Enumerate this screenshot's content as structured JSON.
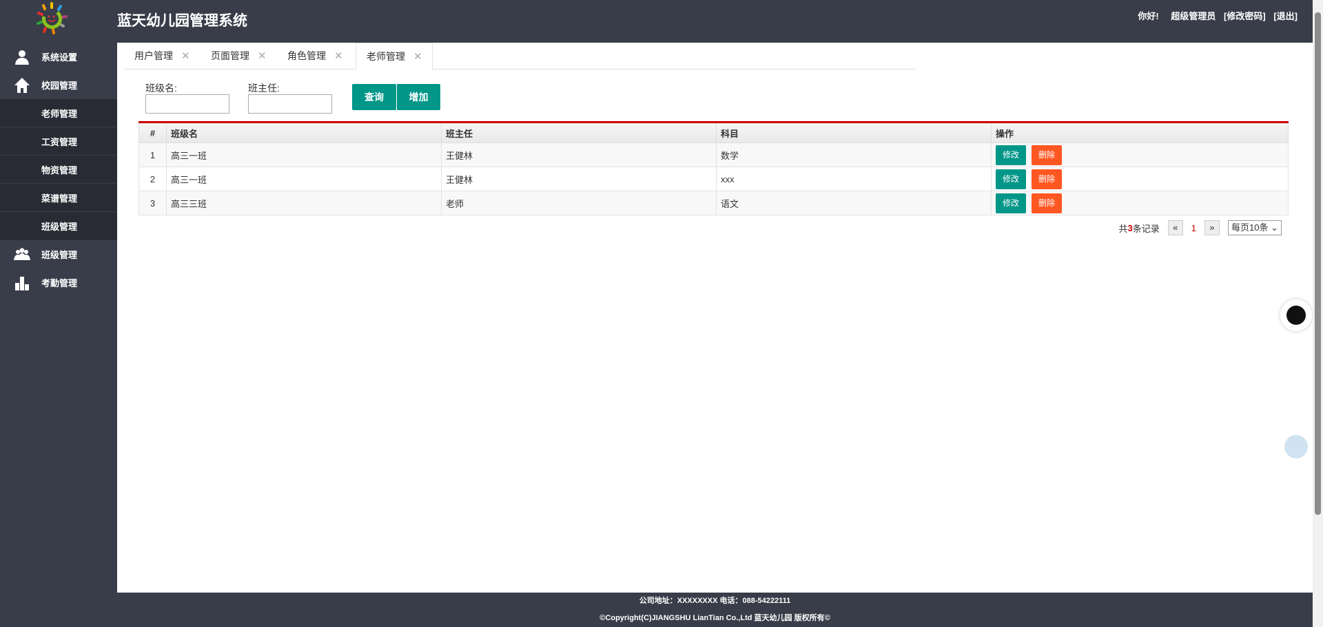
{
  "header": {
    "title": "蓝天幼儿园管理系统",
    "greeting": "你好!",
    "user": "超级管理员",
    "change_password": "[修改密码]",
    "logout": "[退出]"
  },
  "sidebar": {
    "items": [
      {
        "label": "系统设置",
        "icon": "user-icon"
      },
      {
        "label": "校园管理",
        "icon": "home-icon"
      }
    ],
    "sub_items": [
      "老师管理",
      "工资管理",
      "物资管理",
      "菜谱管理",
      "班级管理"
    ],
    "bottom_items": [
      {
        "label": "班级管理",
        "icon": "group-icon"
      },
      {
        "label": "考勤管理",
        "icon": "bar-chart-icon"
      }
    ]
  },
  "tabs": [
    {
      "label": "用户管理",
      "close": "✕"
    },
    {
      "label": "页面管理",
      "close": "✕"
    },
    {
      "label": "角色管理",
      "close": "✕"
    },
    {
      "label": "老师管理",
      "close": "✕",
      "active": true
    }
  ],
  "form": {
    "class_label": "班级名:",
    "class_value": "",
    "teacher_label": "班主任:",
    "teacher_value": "",
    "query": "查询",
    "add": "增加"
  },
  "table": {
    "headers": [
      "#",
      "班级名",
      "班主任",
      "科目",
      "操作"
    ],
    "rows": [
      [
        "1",
        "高三一班",
        "王健林",
        "数学"
      ],
      [
        "2",
        "高三一班",
        "王健林",
        "xxx"
      ],
      [
        "3",
        "高三三班",
        "老师",
        "语文"
      ]
    ],
    "edit": "修改",
    "delete": "删除"
  },
  "pager": {
    "prefix": "共",
    "total": "3",
    "suffix": "条记录",
    "prev": "«",
    "page": "1",
    "next": "»",
    "per_page": "每页10条"
  },
  "footer": {
    "line1": "公司地址：XXXXXXXX 电话：088-54222111",
    "line2": "©Copyright(C)JIANGSHU LianTian Co.,Ltd 蓝天幼儿园 版权所有©"
  },
  "colors": {
    "header": "#393d49",
    "primary": "#009688",
    "danger": "#ff5722",
    "accent": "#cc0000"
  }
}
